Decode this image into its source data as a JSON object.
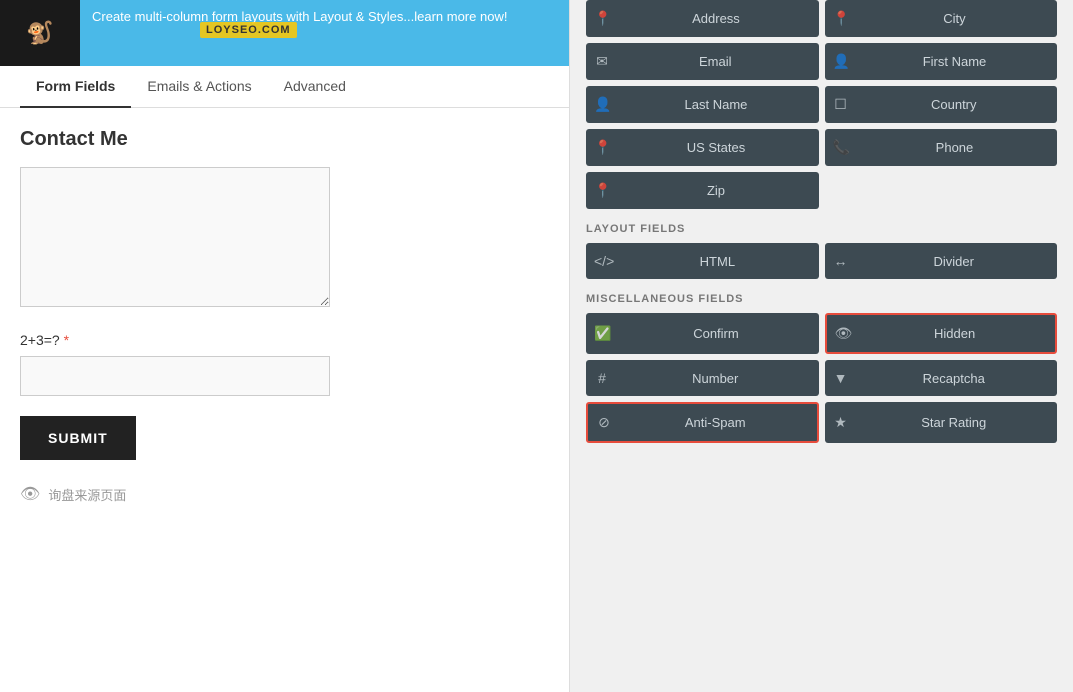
{
  "notification": {
    "text": "Create multi-column form layouts with Layout & Styles...learn more now!"
  },
  "watermark": "LOYSEO.COM",
  "tabs": [
    {
      "label": "Form Fields",
      "active": true
    },
    {
      "label": "Emails & Actions",
      "active": false
    },
    {
      "label": "Advanced",
      "active": false
    }
  ],
  "form": {
    "title": "Contact Me",
    "textarea_placeholder": "",
    "captcha_label": "2+3=?",
    "captcha_required": "*",
    "submit_label": "SUBMIT",
    "footer_text": "询盘来源页面"
  },
  "right_panel": {
    "standard_fields": {
      "label": "",
      "buttons": [
        {
          "icon": "📍",
          "label": "Address"
        },
        {
          "icon": "📍",
          "label": "City"
        },
        {
          "icon": "✉",
          "label": "Email"
        },
        {
          "icon": "👤",
          "label": "First Name"
        },
        {
          "icon": "👤",
          "label": "Last Name"
        },
        {
          "icon": "☐",
          "label": "Country"
        },
        {
          "icon": "📍",
          "label": "US States"
        },
        {
          "icon": "📞",
          "label": "Phone"
        },
        {
          "icon": "📍",
          "label": "Zip"
        }
      ]
    },
    "layout_fields": {
      "label": "LAYOUT FIELDS",
      "buttons": [
        {
          "icon": "</>",
          "label": "HTML"
        },
        {
          "icon": "↔",
          "label": "Divider"
        }
      ]
    },
    "misc_fields": {
      "label": "MISCELLANEOUS FIELDS",
      "buttons": [
        {
          "icon": "✅",
          "label": "Confirm",
          "highlighted": false
        },
        {
          "icon": "👁",
          "label": "Hidden",
          "highlighted": true
        },
        {
          "icon": "#",
          "label": "Number",
          "highlighted": false
        },
        {
          "icon": "▼",
          "label": "Recaptcha",
          "highlighted": false
        },
        {
          "icon": "⊘",
          "label": "Anti-Spam",
          "highlighted": true
        },
        {
          "icon": "★",
          "label": "Star Rating",
          "highlighted": false
        }
      ]
    }
  }
}
